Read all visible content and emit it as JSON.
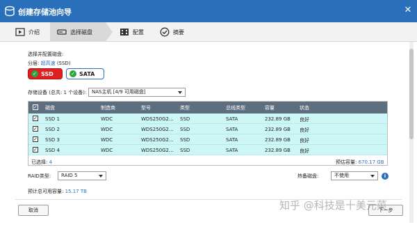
{
  "window": {
    "title": "创建存储池向导",
    "close_icon": "close-icon"
  },
  "steps": [
    {
      "label": "介绍",
      "icon": "play-icon",
      "active": false
    },
    {
      "label": "选择磁盘",
      "icon": "disk-icon",
      "active": true
    },
    {
      "label": "配置",
      "icon": "film-icon",
      "active": false
    },
    {
      "label": "摘要",
      "icon": "check-circle-icon",
      "active": false
    }
  ],
  "select_section": {
    "label": "选择并配置磁盘:"
  },
  "tier": {
    "prefix": "分层: ",
    "link": "超高速",
    "suffix": " (SSD)"
  },
  "disk_types": [
    {
      "label": "SSD",
      "checked": true,
      "color": "#e02020"
    },
    {
      "label": "SATA",
      "checked": true,
      "color": "#2a6fba"
    }
  ],
  "storage_device": {
    "label": "存储设备 (总共: 1 个设备):",
    "selected": "NAS主机 [4/9 可用磁盘]"
  },
  "table": {
    "headers": [
      "磁盘",
      "制造商",
      "型号",
      "类型",
      "总线类型",
      "容量",
      "状态"
    ],
    "rows": [
      [
        "SSD 1",
        "WDC",
        "WDS250G2...",
        "SSD",
        "SATA",
        "232.89 GB",
        "良好"
      ],
      [
        "SSD 2",
        "WDC",
        "WDS250G2...",
        "SSD",
        "SATA",
        "232.89 GB",
        "良好"
      ],
      [
        "SSD 3",
        "WDC",
        "WDS250G2...",
        "SSD",
        "SATA",
        "232.89 GB",
        "良好"
      ],
      [
        "SSD 4",
        "WDC",
        "WDS250G2...",
        "SSD",
        "SATA",
        "232.89 GB",
        "良好"
      ]
    ],
    "selected_label": "已选择: ",
    "selected_count": "4",
    "estimated_label": "预估容量: ",
    "estimated_value": "670.17 GB"
  },
  "raid": {
    "label": "RAID类型:",
    "value": "RAID 5"
  },
  "hot_spare": {
    "label": "热备磁盘:",
    "value": "不使用",
    "info_icon": "i"
  },
  "capacity": {
    "label": "预计总可用容量: ",
    "value": "15.17 TB"
  },
  "buttons": {
    "cancel": "取消",
    "next": "下一步"
  },
  "watermark": "知乎 @科技是十美元菜",
  "colors": {
    "titlebar": "#2a6fba",
    "table_header": "#5d6e7f",
    "row_selected": "#cdf6f6",
    "ssd_badge": "#e02020",
    "link": "#2a6fba"
  }
}
